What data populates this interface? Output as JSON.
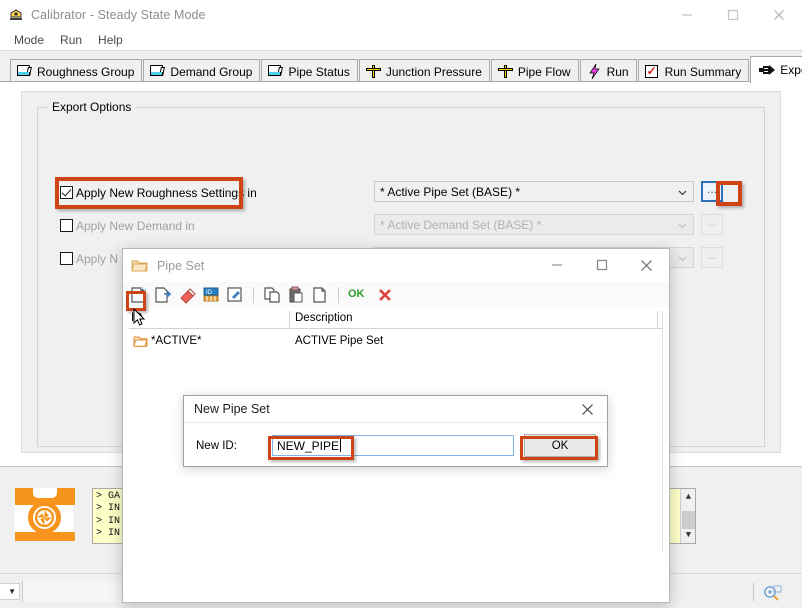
{
  "window": {
    "title": "Calibrator - Steady State Mode",
    "app_icon": "calibrator-icon",
    "minimize": "minimize-icon",
    "maximize": "maximize-icon",
    "close": "close-icon"
  },
  "menu": {
    "items": [
      {
        "label": "Mode"
      },
      {
        "label": "Run"
      },
      {
        "label": "Help"
      }
    ]
  },
  "tabs": [
    {
      "label": "Roughness Group",
      "icon": "folder-icon",
      "active": false
    },
    {
      "label": "Demand Group",
      "icon": "folder-icon",
      "active": false
    },
    {
      "label": "Pipe Status",
      "icon": "folder-icon",
      "active": false
    },
    {
      "label": "Junction Pressure",
      "icon": "junction-icon",
      "active": false
    },
    {
      "label": "Pipe Flow",
      "icon": "junction-icon",
      "active": false
    },
    {
      "label": "Run",
      "icon": "lightning-icon",
      "active": false
    },
    {
      "label": "Run Summary",
      "icon": "report-icon",
      "active": false
    },
    {
      "label": "Export Results",
      "icon": "pointing-hand-icon",
      "active": true
    }
  ],
  "export_options": {
    "group_label": "Export Options",
    "rows": [
      {
        "label": "Apply New Roughness Settings in",
        "checked": true,
        "disabled": false,
        "combo_value": "* Active Pipe Set (BASE) *",
        "browse_label": "...",
        "highlighted": true
      },
      {
        "label": "Apply New Demand in",
        "checked": false,
        "disabled": true,
        "combo_value": "* Active Demand Set (BASE) *",
        "browse_label": "...",
        "highlighted": false
      },
      {
        "label": "Apply N",
        "checked": false,
        "disabled": true,
        "combo_value": "",
        "browse_label": "...",
        "highlighted": false
      }
    ]
  },
  "log": {
    "lines": [
      "> GA",
      "> IN",
      "> IN",
      "> IN"
    ],
    "scroll_up": "scroll-up-arrow",
    "scroll_down": "scroll-down-arrow"
  },
  "status_bar": {
    "zoom_icon": "zoom-in-icon",
    "caret": "chevron-down-icon"
  },
  "pipe_set_dialog": {
    "title": "Pipe Set",
    "icon": "folder-icon",
    "minimize": "minimize-icon",
    "maximize": "maximize-icon",
    "close": "close-icon",
    "toolbar": [
      {
        "name": "new-button",
        "icon": "new-document-icon",
        "highlighted": true
      },
      {
        "name": "open-button",
        "icon": "open-copy-icon",
        "highlighted": false
      },
      {
        "name": "delete-button",
        "icon": "eraser-icon",
        "highlighted": false
      },
      {
        "name": "renumber-button",
        "icon": "id-renumber-icon",
        "highlighted": false
      },
      {
        "name": "edit-button",
        "icon": "edit-pencil-icon",
        "highlighted": false
      },
      {
        "name": "copy-button",
        "icon": "copy-icon",
        "highlighted": false
      },
      {
        "name": "paste-button",
        "icon": "paste-icon",
        "highlighted": false
      },
      {
        "name": "duplicate-button",
        "icon": "duplicate-icon",
        "highlighted": false
      },
      {
        "name": "ok-button",
        "icon": "ok-text-icon",
        "label": "OK",
        "highlighted": false
      },
      {
        "name": "cancel-button",
        "icon": "red-x-icon",
        "highlighted": false
      }
    ],
    "columns": [
      "ID",
      "Description"
    ],
    "rows": [
      {
        "id": "*ACTIVE*",
        "description": "ACTIVE Pipe Set",
        "icon": "folder-icon"
      }
    ]
  },
  "new_pipe_set_dialog": {
    "title": "New Pipe Set",
    "close": "close-icon",
    "field_label": "New ID:",
    "field_value": "NEW_PIPE",
    "field_placeholder": "",
    "ok_label": "OK"
  },
  "colors": {
    "highlight": "#cf4417",
    "focus_border": "#2f6fb3",
    "log_background": "#ffffc8",
    "accent_orange": "#f7941d"
  }
}
